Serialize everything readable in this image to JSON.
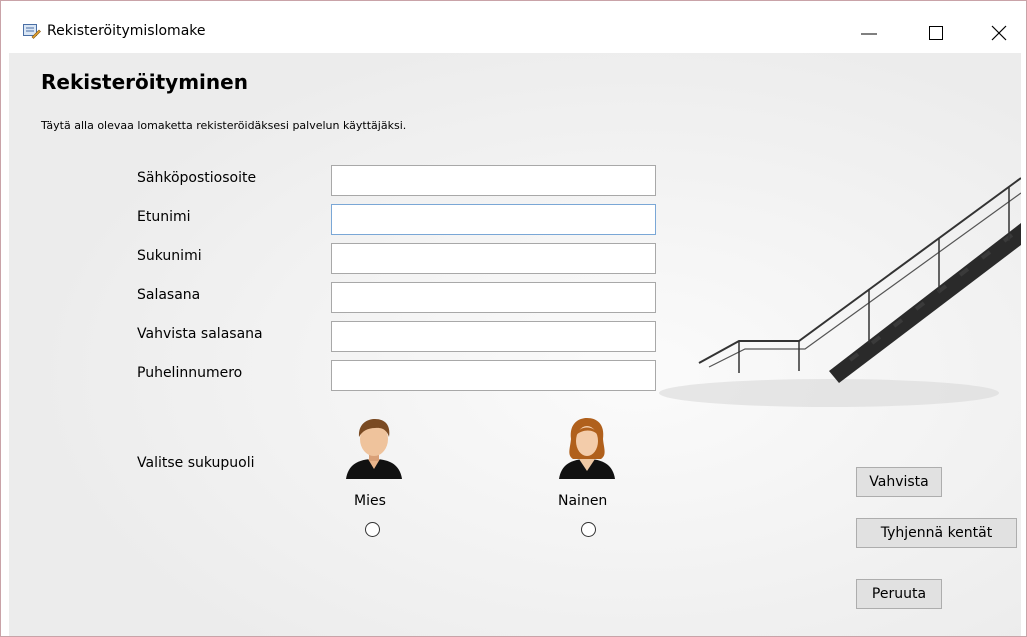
{
  "window": {
    "title": "Rekisteröitymislomake"
  },
  "form": {
    "heading": "Rekisteröityminen",
    "subtitle": "Täytä alla olevaa lomaketta rekisteröidäksesi palvelun käyttäjäksi.",
    "fields": [
      {
        "label": "Sähköpostiosoite",
        "value": ""
      },
      {
        "label": "Etunimi",
        "value": ""
      },
      {
        "label": "Sukunimi",
        "value": ""
      },
      {
        "label": "Salasana",
        "value": ""
      },
      {
        "label": "Vahvista salasana",
        "value": ""
      },
      {
        "label": "Puhelinnumero",
        "value": ""
      }
    ],
    "gender": {
      "label": "Valitse sukupuoli",
      "options": [
        {
          "label": "Mies",
          "icon": "male-avatar-icon",
          "selected": false
        },
        {
          "label": "Nainen",
          "icon": "female-avatar-icon",
          "selected": false
        }
      ]
    }
  },
  "buttons": {
    "confirm": "Vahvista",
    "clear": "Tyhjennä kentät",
    "cancel": "Peruuta"
  },
  "colors": {
    "window_border": "#c9a3a8",
    "focused_border": "#7aa7d6",
    "button_face": "#e1e1e1"
  }
}
